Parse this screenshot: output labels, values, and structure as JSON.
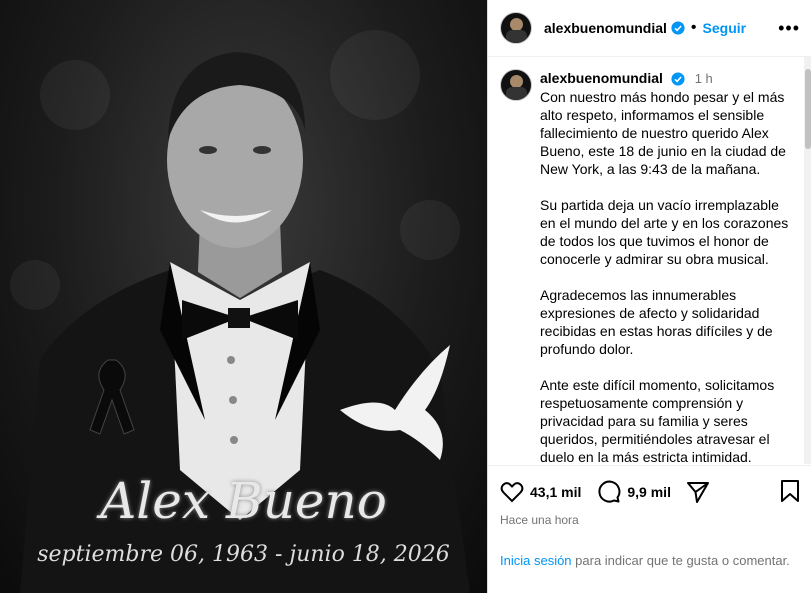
{
  "post": {
    "image": {
      "title": "Alex Bueno",
      "dates": "septiembre 06, 1963 - junio 18, 2026"
    }
  },
  "header": {
    "username": "alexbuenomundial",
    "follow_label": "Seguir",
    "more_icon": "more-horizontal-icon"
  },
  "caption": {
    "username": "alexbuenomundial",
    "time": "1 h",
    "paragraphs": [
      "Con nuestro más hondo pesar y el más alto respeto, informamos el sensible fallecimiento de nuestro querido Alex Bueno, este 18 de junio en la ciudad de New York, a las 9:43 de la mañana.",
      "Su partida deja un vacío irremplazable en el mundo del arte y en los corazones de todos los que tuvimos el honor de conocerle y admirar su obra musical.",
      "Agradecemos las innumerables expresiones de afecto y solidaridad recibidas en estas horas difíciles y de profundo dolor.",
      "Ante este difícil momento, solicitamos respetuosamente comprensión y privacidad para su familia y seres queridos, permitiéndoles atravesar el duelo en la más estricta intimidad."
    ]
  },
  "actions": {
    "likes": "43,1 mil",
    "comments": "9,9 mil",
    "posted_ago": "Hace una hora"
  },
  "login": {
    "link": "Inicia sesión",
    "rest": " para indicar que te gusta o comentar."
  },
  "colors": {
    "accent": "#0095f6",
    "verified": "#0095f6",
    "muted": "#737373"
  }
}
